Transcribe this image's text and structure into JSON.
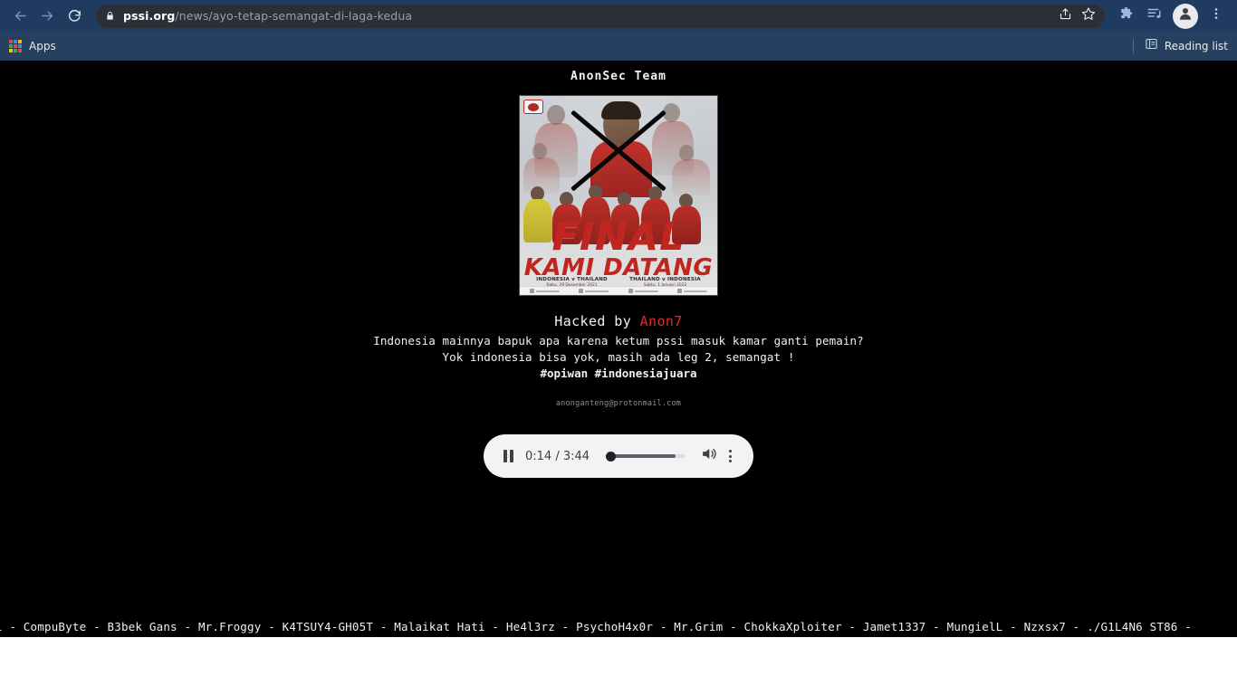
{
  "browser": {
    "nav": {
      "back_icon": "arrow-left-icon",
      "forward_icon": "arrow-right-icon",
      "reload_icon": "reload-icon"
    },
    "omnibox": {
      "lock_icon": "lock-icon",
      "host": "pssi.org",
      "path": "/news/ayo-tetap-semangat-di-laga-kedua",
      "share_icon": "share-icon",
      "bookmark_icon": "star-icon"
    },
    "toolbar": {
      "extensions_icon": "puzzle-piece-icon",
      "reading_list_icon": "reading-list-icon",
      "profile_icon": "avatar-icon",
      "menu_icon": "three-dot-menu-icon"
    },
    "bookmarks_bar": {
      "apps_label": "Apps",
      "apps_icon": "apps-grid-icon",
      "reading_list_label": "Reading list",
      "reading_list_icon": "reading-list-panel-icon"
    },
    "colors": {
      "toolbar_bg": "#1f3c60",
      "bookmarks_bg": "#27405f",
      "omnibox_bg": "#2b3038"
    }
  },
  "page": {
    "team_title": "AnonSec Team",
    "poster": {
      "headline_line1": "FINAL",
      "headline_line2": "KAMI DATANG",
      "fixture_left_teams": "INDONESIA v THAILAND",
      "fixture_left_date": "Rabu, 29 Desember 2021",
      "fixture_right_teams": "THAILAND v INDONESIA",
      "fixture_right_date": "Sabtu, 1 Januari 2022",
      "logo": "pssi-logo-icon",
      "overlay": "black-x-cross-mark"
    },
    "message": {
      "hacked_prefix": "Hacked by ",
      "hacked_nick": "Anon7",
      "nick_color": "#e02b2b",
      "line1": "Indonesia mainnya bapuk apa karena ketum pssi masuk kamar ganti pemain?",
      "line2": "Yok indonesia bisa yok, masih ada leg 2, semangat !",
      "tags": "#opiwan #indonesiajuara",
      "email": "anonganteng@protonmail.com"
    },
    "audio_player": {
      "play_pause_icon": "pause-icon",
      "current_time": "0:14",
      "separator": " / ",
      "duration": "3:44",
      "time_display": "0:14 / 3:44",
      "progress_percent": 88,
      "volume_icon": "volume-high-icon",
      "menu_icon": "three-dot-menu-icon"
    },
    "marquee": {
      "text": "megai - CompuByte - B3bek Gans - Mr.Froggy - K4TSUY4-GH05T - Malaikat Hati - He4l3rz - PsychoH4x0r - Mr.Grim - ChokkaXploiter - Jamet1337 - MungielL - Nzxsx7 - ./G1L4N6 ST86 -"
    }
  }
}
